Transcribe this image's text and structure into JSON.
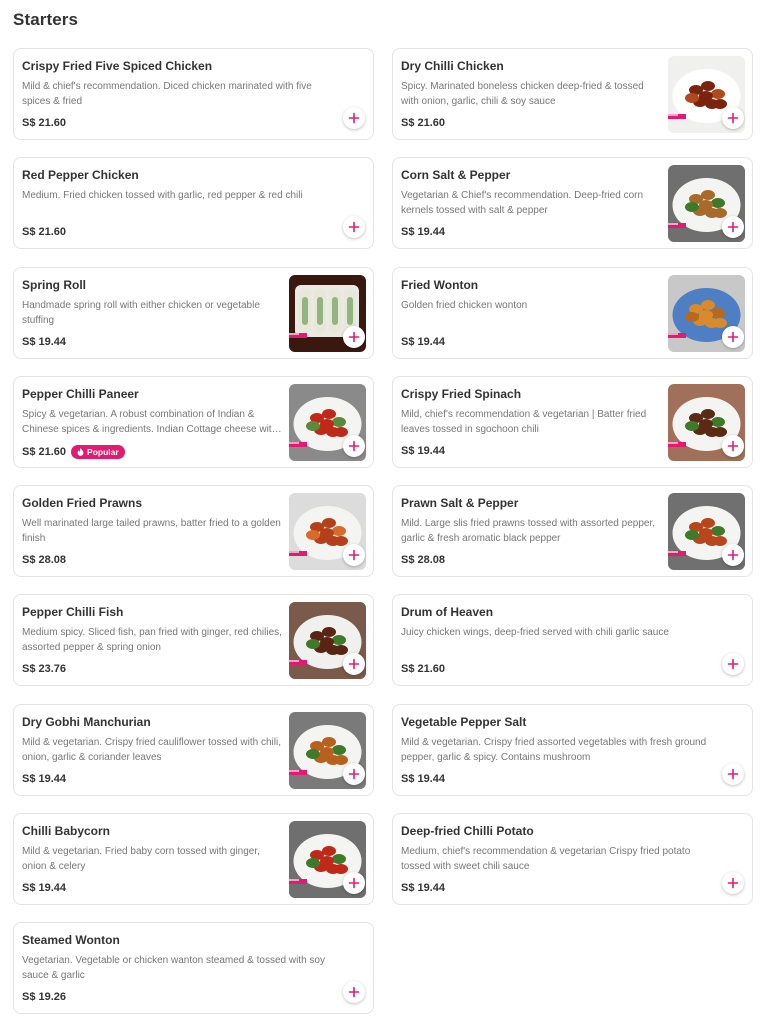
{
  "section": {
    "title": "Starters"
  },
  "popular_label": "Popular",
  "colors": {
    "accent": "#e21b70",
    "card_border": "#e4e4e4",
    "description": "#777777"
  },
  "icons": {
    "add": "plus-icon",
    "popular": "flame-icon"
  },
  "items": [
    {
      "name": "Crispy Fried Five Spiced Chicken",
      "description": "Mild & chief's recommendation. Diced chicken marinated with five spices & fried",
      "price": "S$ 21.60",
      "popular": false,
      "has_image": false
    },
    {
      "name": "Dry Chilli Chicken",
      "description": "Spicy. Marinated boneless chicken deep-fried & tossed with onion, garlic, chili & soy sauce",
      "price": "S$ 21.60",
      "popular": false,
      "has_image": true
    },
    {
      "name": "Red Pepper Chicken",
      "description": "Medium. Fried chicken tossed with garlic, red pepper & red chili",
      "price": "S$ 21.60",
      "popular": false,
      "has_image": false
    },
    {
      "name": "Corn Salt & Pepper",
      "description": "Vegetarian & Chief's recommendation. Deep-fried corn kernels tossed with salt & pepper",
      "price": "S$ 19.44",
      "popular": false,
      "has_image": true
    },
    {
      "name": "Spring Roll",
      "description": "Handmade spring roll with either chicken or vegetable stuffing",
      "price": "S$ 19.44",
      "popular": false,
      "has_image": true
    },
    {
      "name": "Fried Wonton",
      "description": "Golden fried chicken wonton",
      "price": "S$ 19.44",
      "popular": false,
      "has_image": true
    },
    {
      "name": "Pepper Chilli Paneer",
      "description": "Spicy & vegetarian. A robust combination of Indian & Chinese spices & ingredients. Indian Cottage cheese with sweet & spicy sauce",
      "price": "S$ 21.60",
      "popular": true,
      "has_image": true
    },
    {
      "name": "Crispy Fried Spinach",
      "description": "Mild, chief's recommendation & vegetarian | Batter fried leaves tossed in sgochoon chili",
      "price": "S$ 19.44",
      "popular": false,
      "has_image": true
    },
    {
      "name": "Golden Fried Prawns",
      "description": "Well marinated large tailed prawns, batter fried to a golden finish",
      "price": "S$ 28.08",
      "popular": false,
      "has_image": true
    },
    {
      "name": "Prawn Salt & Pepper",
      "description": "Mild. Large slis fried prawns tossed with assorted pepper, garlic & fresh aromatic black pepper",
      "price": "S$ 28.08",
      "popular": false,
      "has_image": true
    },
    {
      "name": "Pepper Chilli Fish",
      "description": "Medium spicy. Sliced fish, pan fried with ginger, red chilies, assorted pepper & spring onion",
      "price": "S$ 23.76",
      "popular": false,
      "has_image": true
    },
    {
      "name": "Drum of Heaven",
      "description": "Juicy chicken wings, deep-fried served with chili garlic sauce",
      "price": "S$ 21.60",
      "popular": false,
      "has_image": false
    },
    {
      "name": "Dry Gobhi Manchurian",
      "description": "Mild & vegetarian. Crispy fried cauliflower tossed with chili, onion, garlic & coriander leaves",
      "price": "S$ 19.44",
      "popular": false,
      "has_image": true
    },
    {
      "name": "Vegetable Pepper Salt",
      "description": "Mild & vegetarian. Crispy fried assorted vegetables with fresh ground pepper, garlic & spicy. Contains mushroom",
      "price": "S$ 19.44",
      "popular": false,
      "has_image": false
    },
    {
      "name": "Chilli Babycorn",
      "description": "Mild & vegetarian. Fried baby corn tossed with ginger, onion & celery",
      "price": "S$ 19.44",
      "popular": false,
      "has_image": true
    },
    {
      "name": "Deep-fried Chilli Potato",
      "description": "Medium, chief's recommendation & vegetarian Crispy fried potato tossed with sweet chili sauce",
      "price": "S$ 19.44",
      "popular": false,
      "has_image": false
    },
    {
      "name": "Steamed Wonton",
      "description": "Vegetarian. Vegetable or chicken wanton steamed & tossed with soy sauce & garlic",
      "price": "S$ 19.26",
      "popular": false,
      "has_image": false
    }
  ]
}
